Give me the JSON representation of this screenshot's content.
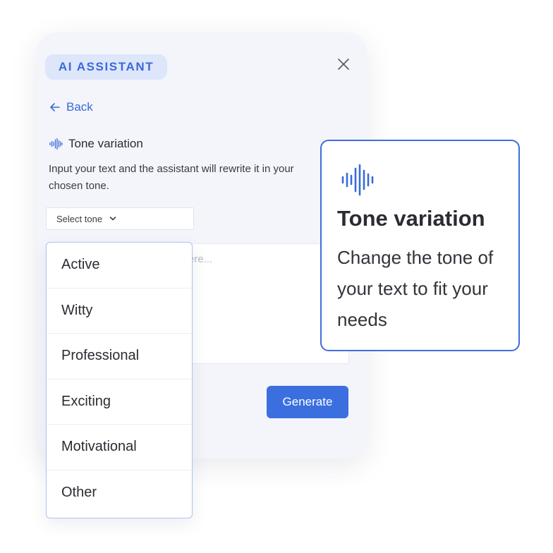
{
  "panel": {
    "badge_label": "AI ASSISTANT",
    "back_label": "Back",
    "section_title": "Tone variation",
    "description": "Input your text and the assistant will rewrite it in your chosen tone.",
    "select": {
      "label": "Select tone"
    },
    "textarea": {
      "placeholder_visible": "ere..."
    },
    "generate_label": "Generate"
  },
  "dropdown": {
    "options": [
      "Active",
      "Witty",
      "Professional",
      "Exciting",
      "Motivational",
      "Other"
    ]
  },
  "feature_card": {
    "title": "Tone variation",
    "body": "Change the tone of your text to fit your needs"
  },
  "icons": {
    "close": "close-icon",
    "back": "arrow-left-icon",
    "waveform": "waveform-icon",
    "chevron": "chevron-down-icon"
  },
  "colors": {
    "accent": "#3b6fe0",
    "badge_bg": "#dde6fb",
    "panel_bg": "#f4f5fa",
    "card_border": "#3f6ddb"
  }
}
